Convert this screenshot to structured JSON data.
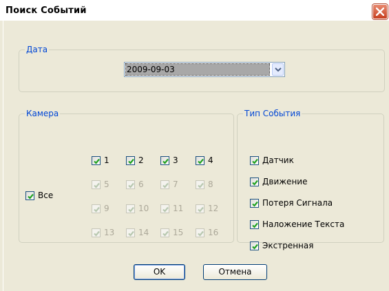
{
  "window": {
    "title": "Поиск Событий",
    "close_icon": "close-icon"
  },
  "date_group": {
    "legend": "Дата",
    "selected_date": "2009-09-03"
  },
  "camera_group": {
    "legend": "Камера",
    "all_label": "Все",
    "all_checked": true,
    "cameras": [
      {
        "label": "1",
        "checked": true,
        "enabled": true
      },
      {
        "label": "2",
        "checked": true,
        "enabled": true
      },
      {
        "label": "3",
        "checked": true,
        "enabled": true
      },
      {
        "label": "4",
        "checked": true,
        "enabled": true
      },
      {
        "label": "5",
        "checked": true,
        "enabled": false
      },
      {
        "label": "6",
        "checked": true,
        "enabled": false
      },
      {
        "label": "7",
        "checked": true,
        "enabled": false
      },
      {
        "label": "8",
        "checked": true,
        "enabled": false
      },
      {
        "label": "9",
        "checked": true,
        "enabled": false
      },
      {
        "label": "10",
        "checked": true,
        "enabled": false
      },
      {
        "label": "11",
        "checked": true,
        "enabled": false
      },
      {
        "label": "12",
        "checked": true,
        "enabled": false
      },
      {
        "label": "13",
        "checked": true,
        "enabled": false
      },
      {
        "label": "14",
        "checked": true,
        "enabled": false
      },
      {
        "label": "15",
        "checked": true,
        "enabled": false
      },
      {
        "label": "16",
        "checked": true,
        "enabled": false
      }
    ]
  },
  "event_type_group": {
    "legend": "Тип События",
    "items": [
      {
        "label": "Датчик",
        "checked": true
      },
      {
        "label": "Движение",
        "checked": true
      },
      {
        "label": "Потеря Сигнала",
        "checked": true
      },
      {
        "label": "Наложение Текста",
        "checked": true
      },
      {
        "label": "Экстренная",
        "checked": true
      }
    ]
  },
  "buttons": {
    "ok_label": "OK",
    "cancel_label": "Отмена"
  },
  "colors": {
    "legend_text": "#0046d5",
    "checkmark": "#21a121",
    "checkmark_disabled": "#b8c8b0",
    "face": "#ece9d8"
  }
}
